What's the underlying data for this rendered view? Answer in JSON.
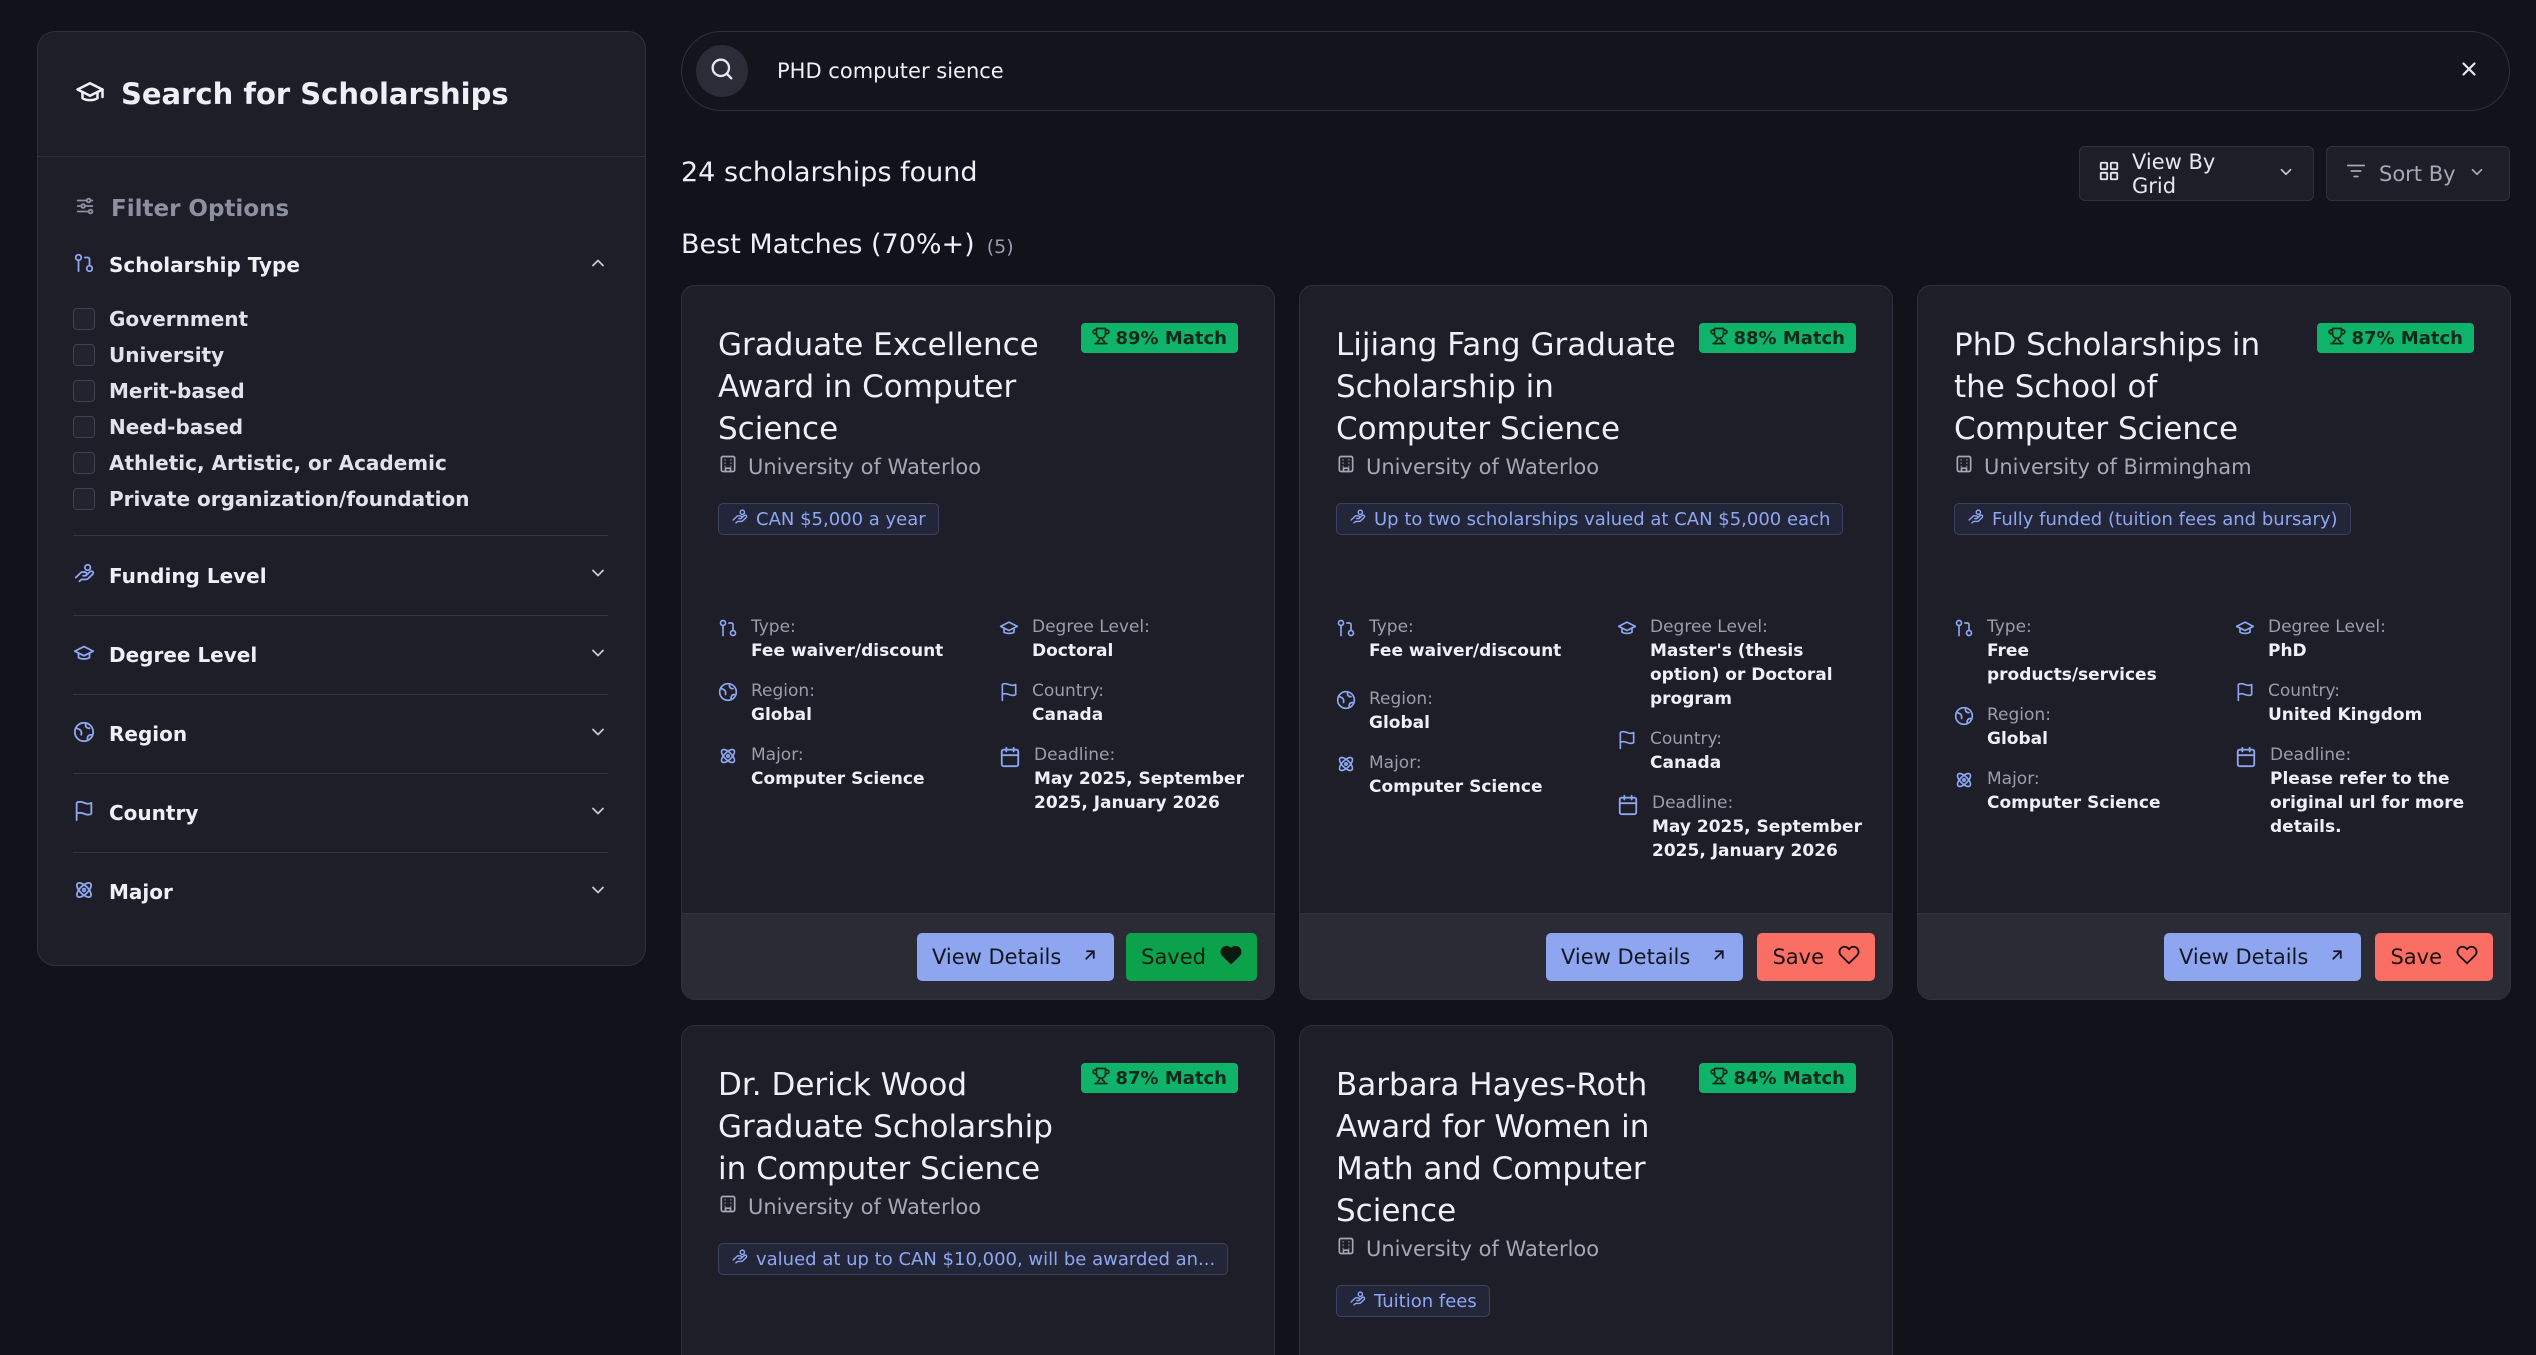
{
  "sidebar": {
    "title": "Search for Scholarships",
    "filter_heading": "Filter Options",
    "scholarship_type": {
      "label": "Scholarship Type",
      "options": [
        "Government",
        "University",
        "Merit-based",
        "Need-based",
        "Athletic, Artistic, or Academic",
        "Private organization/foundation"
      ]
    },
    "sections": [
      "Funding Level",
      "Degree Level",
      "Region",
      "Country",
      "Major"
    ]
  },
  "search": {
    "value": "PHD computer sience"
  },
  "results": {
    "count_text": "24 scholarships found",
    "view_label": "View By Grid",
    "sort_label": "Sort By",
    "best_title": "Best Matches (70%+)",
    "best_count": "(5)"
  },
  "labels": {
    "type": "Type:",
    "degree": "Degree Level:",
    "region": "Region:",
    "country": "Country:",
    "major": "Major:",
    "deadline": "Deadline:",
    "view_details": "View Details",
    "save": "Save",
    "saved": "Saved"
  },
  "colors": {
    "match_green": "#10b36a",
    "view_blue": "#8da6ef",
    "save_red": "#fa6e64",
    "saved_green": "#0ca24c"
  },
  "cards": [
    {
      "title": "Graduate Excellence Award in Computer Science",
      "match": "89% Match",
      "university": "University of Waterloo",
      "funding": "CAN $5,000 a year",
      "type": "Fee waiver/discount",
      "degree": "Doctoral",
      "region": "Global",
      "country": "Canada",
      "major": "Computer Science",
      "deadline": "May 2025, September 2025, January 2026",
      "saved": true
    },
    {
      "title": "Lijiang Fang Graduate Scholarship in Computer Science",
      "match": "88% Match",
      "university": "University of Waterloo",
      "funding": "Up to two scholarships valued at CAN $5,000 each",
      "type": "Fee waiver/discount",
      "degree": "Master's (thesis option) or Doctoral program",
      "region": "Global",
      "country": "Canada",
      "major": "Computer Science",
      "deadline": "May 2025, September 2025, January 2026",
      "saved": false
    },
    {
      "title": "PhD Scholarships in the School of Computer Science",
      "match": "87% Match",
      "university": "University of Birmingham",
      "funding": "Fully funded (tuition fees and bursary)",
      "type": "Free products/services",
      "degree": "PhD",
      "region": "Global",
      "country": "United Kingdom",
      "major": "Computer Science",
      "deadline": "Please refer to the original url for more details.",
      "saved": false
    },
    {
      "title": "Dr. Derick Wood Graduate Scholarship in Computer Science",
      "match": "87% Match",
      "university": "University of Waterloo",
      "funding": "valued at up to CAN $10,000, will be awarded an..."
    },
    {
      "title": "Barbara Hayes-Roth Award for Women in Math and Computer Science",
      "match": "84% Match",
      "university": "University of Waterloo",
      "funding": "Tuition fees"
    }
  ]
}
